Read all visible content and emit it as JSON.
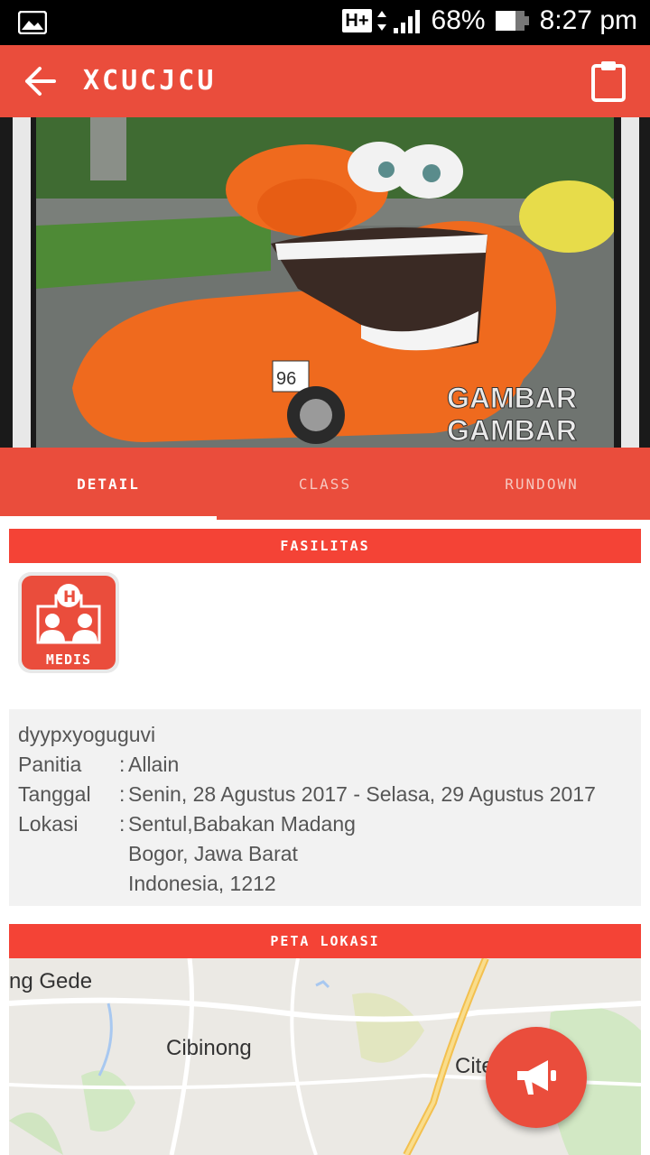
{
  "status_bar": {
    "network": "H+",
    "battery": "68%",
    "time": "8:27 pm"
  },
  "app_bar": {
    "title": "XCUCJCU"
  },
  "hero": {
    "watermark_line1": "GAMBAR",
    "watermark_line2": "GAMBAR",
    "plate": "96"
  },
  "tabs": [
    {
      "label": "DETAIL",
      "active": true
    },
    {
      "label": "CLASS",
      "active": false
    },
    {
      "label": "RUNDOWN",
      "active": false
    }
  ],
  "facilities": {
    "header": "FASILITAS",
    "items": [
      {
        "icon": "medical-icon",
        "label": "MEDIS"
      }
    ]
  },
  "detail": {
    "description": "dyypxyoguguvi",
    "panitia_label": "Panitia",
    "panitia_value": "Allain",
    "tanggal_label": "Tanggal",
    "tanggal_value": "Senin, 28 Agustus 2017 - Selasa, 29 Agustus 2017",
    "lokasi_label": "Lokasi",
    "lokasi_line1": "Sentul,Babakan Madang",
    "lokasi_line2": "Bogor, Jawa Barat",
    "lokasi_line3": "Indonesia, 1212",
    "separator": ":"
  },
  "map_section": {
    "header": "PETA LOKASI",
    "places": [
      "ng Gede",
      "Cibinong",
      "Cite"
    ]
  },
  "fab": {
    "icon": "megaphone-icon"
  },
  "colors": {
    "primary": "#ea4d3c",
    "section_header": "#f44336",
    "info_bg": "#f2f2f2"
  }
}
